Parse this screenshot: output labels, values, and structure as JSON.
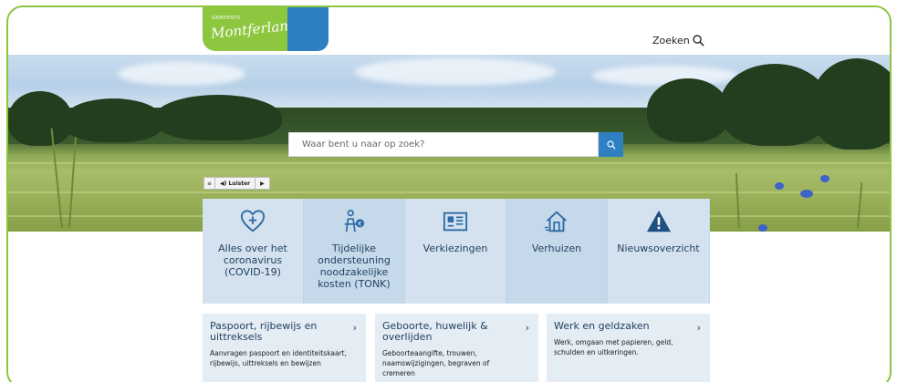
{
  "header": {
    "logo_small": "GEMEENTE",
    "logo_name": "Montferland",
    "search_label": "Zoeken"
  },
  "hero": {
    "search_placeholder": "Waar bent u naar op zoek?",
    "listen_label": "Luister"
  },
  "tiles": [
    {
      "icon": "heart-plus-icon",
      "label": "Alles over het coronavirus (COVID-19)"
    },
    {
      "icon": "person-money-icon",
      "label": "Tijdelijke ondersteuning noodzakelijke kosten (TONK)"
    },
    {
      "icon": "ballot-card-icon",
      "label": "Verkiezingen"
    },
    {
      "icon": "house-move-icon",
      "label": "Verhuizen"
    },
    {
      "icon": "warning-icon",
      "label": "Nieuwsoverzicht"
    }
  ],
  "cards": [
    {
      "title": "Paspoort, rijbewijs en uittreksels",
      "description": "Aanvragen paspoort en identiteitskaart, rijbewijs, uittreksels en bewijzen"
    },
    {
      "title": "Geboorte, huwelijk & overlijden",
      "description": "Geboorteaangifte, trouwen, naamswijzigingen, begraven of cremeren"
    },
    {
      "title": "Werk en geldzaken",
      "description": "Werk, omgaan met papieren, geld, schulden en uitkeringen."
    }
  ],
  "colors": {
    "brand_green": "#8dc63f",
    "brand_blue": "#2f7fc3",
    "tile_bg": "#d3e2ee",
    "text_dark_blue": "#1f3f5f"
  }
}
